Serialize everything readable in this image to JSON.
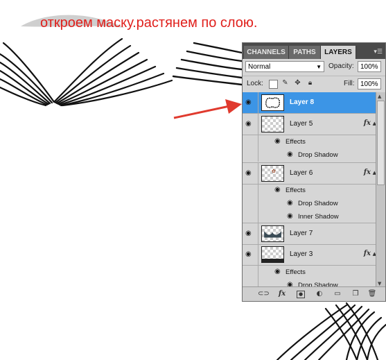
{
  "caption": "откроем маску.растянем по слою.",
  "panel": {
    "tabs": [
      {
        "label": "CHANNELS",
        "active": false
      },
      {
        "label": "PATHS",
        "active": false
      },
      {
        "label": "LAYERS",
        "active": true
      }
    ],
    "blend_mode": "Normal",
    "opacity_label": "Opacity:",
    "opacity_value": "100%",
    "lock_label": "Lock:",
    "fill_label": "Fill:",
    "fill_value": "100%",
    "layers": [
      {
        "name": "Layer 8",
        "selected": true,
        "effects": []
      },
      {
        "name": "Layer 5",
        "selected": false,
        "fx": "fx",
        "effects_label": "Effects",
        "effects": [
          "Drop Shadow"
        ]
      },
      {
        "name": "Layer 6",
        "selected": false,
        "fx": "fx",
        "effects_label": "Effects",
        "effects": [
          "Drop Shadow",
          "Inner Shadow"
        ]
      },
      {
        "name": "Layer 7",
        "selected": false,
        "effects": []
      },
      {
        "name": "Layer 3",
        "selected": false,
        "fx": "fx",
        "effects_label": "Effects",
        "effects": [
          "Drop Shadow"
        ]
      }
    ],
    "footer_icons": [
      "link-icon",
      "fx-icon",
      "mask-icon",
      "adjustment-icon",
      "group-folder-icon",
      "new-layer-icon",
      "trash-icon"
    ]
  },
  "colors": {
    "caption": "#e0201c",
    "selection": "#3c95e6",
    "arrow": "#e03a2e"
  }
}
